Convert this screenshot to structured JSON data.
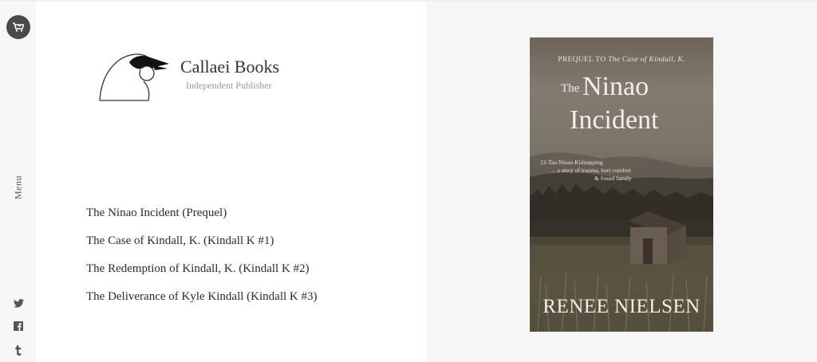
{
  "sidebar": {
    "cart_icon": "shopping-cart-icon",
    "menu_label": "Menu",
    "social": [
      {
        "name": "twitter",
        "icon": "twitter-icon"
      },
      {
        "name": "facebook",
        "icon": "facebook-icon"
      },
      {
        "name": "tumblr",
        "icon": "tumblr-icon"
      }
    ]
  },
  "brand": {
    "name": "Callaei Books",
    "tagline": "Independent Publisher",
    "logo_icon": "bird-head-logo"
  },
  "books": [
    "The Ninao Incident (Prequel)",
    "The Case of Kindall, K. (Kindall K #1)",
    "The Redemption of Kindall, K. (Kindall K #2)",
    "The Deliverance of Kyle Kindall (Kindall K #3)"
  ],
  "cover": {
    "prequel_prefix": "PREQUEL TO",
    "prequel_title": "The Case of Kindall, K.",
    "title_the": "The",
    "title_line1": "Ninao",
    "title_line2": "Incident",
    "blurb": [
      "12-Tau Ninao Kidnapping",
      "... a story of trauma, hurt comfort",
      "& found family"
    ],
    "author": "RENEE NIELSEN"
  },
  "colors": {
    "rail_bg": "#f7f7f7",
    "right_bg": "#f6f6f6",
    "cart_bg": "#4a4a4a",
    "text": "#2b2b2b"
  }
}
